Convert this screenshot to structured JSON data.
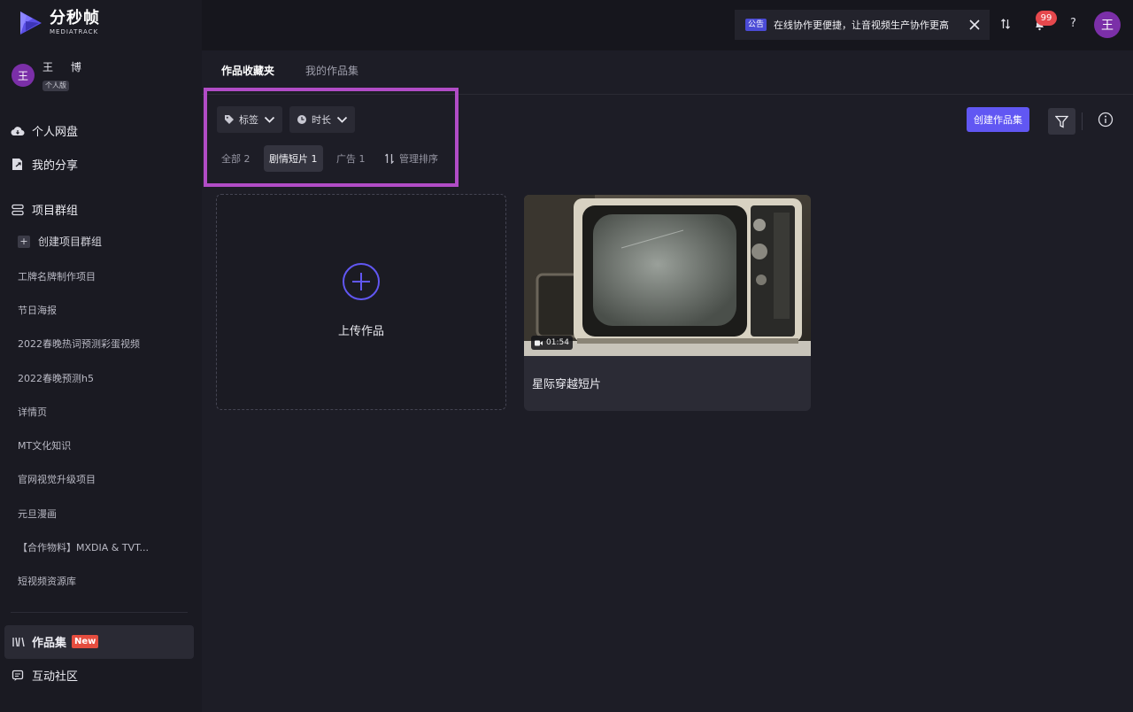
{
  "brand": {
    "name_cn": "分秒帧",
    "name_en": "MEDIATRACK",
    "accent": "#6157f3"
  },
  "user": {
    "avatar": "王",
    "name": "王 博",
    "plan": "个人版"
  },
  "sidebar": {
    "primary": [
      {
        "label": "个人网盘",
        "icon": "cloud-icon"
      },
      {
        "label": "我的分享",
        "icon": "share-icon"
      }
    ],
    "groups_label": "项目群组",
    "create_group": "创建项目群组",
    "plus": "+",
    "groups": [
      "工牌名牌制作项目",
      "节日海报",
      "2022春晚热词预测彩蛋视频",
      "2022春晚预测h5",
      "详情页",
      "MT文化知识",
      "官网视觉升级项目",
      "元旦漫画",
      "【合作物料】MXDIA & TVT...",
      "短视频资源库"
    ],
    "collections": {
      "label": "作品集",
      "badge": "New"
    },
    "community": {
      "label": "互动社区"
    }
  },
  "topbar": {
    "notice_tag": "公告",
    "notice_text": "在线协作更便捷，让音视频生产协作更高",
    "notification_count": "99",
    "help": "?",
    "avatar": "王"
  },
  "tabs": [
    {
      "label": "作品收藏夹",
      "active": true
    },
    {
      "label": "我的作品集",
      "active": false
    }
  ],
  "filters": {
    "tag_dropdown": "标签",
    "duration_dropdown": "时长",
    "chips": [
      {
        "label": "全部 2",
        "active": false
      },
      {
        "label": "剧情短片 1",
        "active": true
      },
      {
        "label": "广告 1",
        "active": false
      }
    ],
    "sort": "管理排序"
  },
  "actions": {
    "create_collection": "创建作品集"
  },
  "upload": {
    "label": "上传作品"
  },
  "works": [
    {
      "title": "星际穿越短片",
      "duration": "01:54"
    }
  ]
}
